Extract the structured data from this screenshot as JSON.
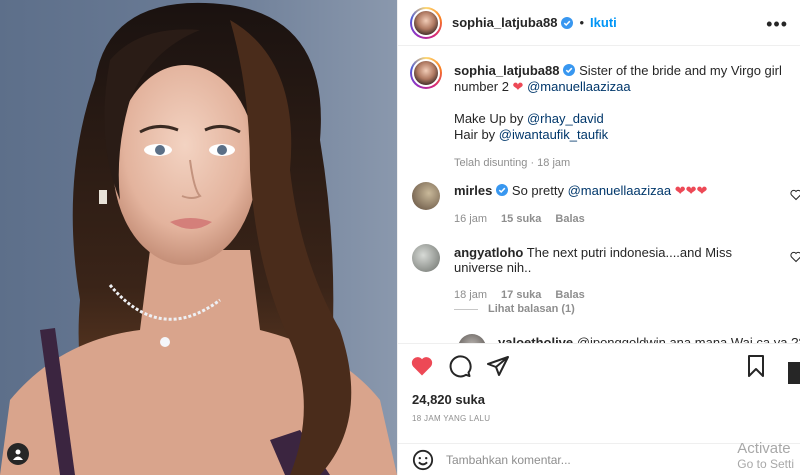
{
  "post": {
    "username": "sophia_latjuba88",
    "follow_label": "Ikuti",
    "separator": "•",
    "caption": {
      "part1": " Sister of the bride and my Virgo girl number 2 ",
      "emoji": "❤",
      "mention1": "@manuellaazizaa",
      "makeup_prefix": "Make Up by ",
      "makeup_mention": "@rhay_david",
      "hair_prefix": "Hair by ",
      "hair_mention": "@iwantaufik_taufik",
      "meta": "Telah disunting · 18 jam"
    },
    "comments": [
      {
        "user": "mirles",
        "text": " So pretty ",
        "mention": "@manuellaazizaa",
        "emoji": " ❤❤❤",
        "time": "16 jam",
        "likes": "15 suka",
        "reply": "Balas"
      },
      {
        "user": "angyatloho",
        "text": " The next putri indonesia....and Miss universe nih..",
        "time": "18 jam",
        "likes": "17 suka",
        "reply": "Balas",
        "view_replies": "Lihat balasan (1)"
      },
      {
        "user": "yaloetholive",
        "text": " @iponggoldwin ana mana Wai ca ya ??"
      }
    ],
    "likes_count": "24,820 suka",
    "timestamp": "18 JAM YANG LALU",
    "comment_placeholder": "Tambahkan komentar...",
    "watermark": {
      "line1": "Activate",
      "line2": "Go to Setti"
    },
    "icons": {
      "like": "heart-icon",
      "comment": "comment-icon",
      "share": "send-icon",
      "save": "bookmark-icon",
      "emoji": "smiley-icon",
      "more": "more-icon",
      "tag": "user-tag-icon"
    },
    "colors": {
      "accent": "#0095f6",
      "like_red": "#ed4956",
      "mention": "#00376b"
    }
  }
}
